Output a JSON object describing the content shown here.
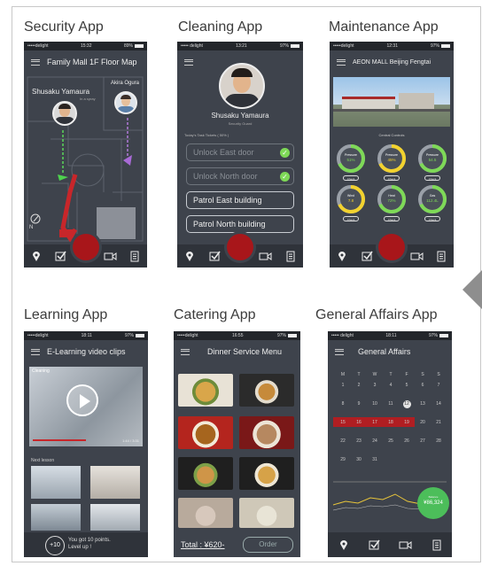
{
  "titles": {
    "security": "Security App",
    "cleaning": "Cleaning App",
    "maintenance": "Maintenance App",
    "learning": "Learning App",
    "catering": "Catering App",
    "general": "General Affairs App"
  },
  "status": {
    "carrier": "•••••delight",
    "carrier_b": "••••• delight",
    "carrier_c": "•••••delight",
    "carrier_d": "••••• delight",
    "battery": "89%",
    "battery_b": "97%",
    "battery_c": "97%",
    "battery_d": "97%",
    "battery_e": "97%",
    "battery_f": "97%",
    "time_a": "15:32",
    "time_b": "13:21",
    "time_c": "12:31",
    "time_d": "18:11",
    "time_e": "16:55",
    "time_f": "18:11"
  },
  "security": {
    "header": "Family Mall 1F Floor Map",
    "user1": "Shusaku Yamaura",
    "user1_sub": "In a spray",
    "user2": "Akira Ogura",
    "compass": "N"
  },
  "cleaning": {
    "name": "Shusaku Yamaura",
    "role": "Security Guard",
    "task_label": "Today's Task Tickets ( 50% )",
    "tasks": [
      "Unlock East door",
      "Unlock North door",
      "Patrol East building",
      "Patrol North building"
    ]
  },
  "maintenance": {
    "header": "AEON MALL Beijing Fengtai",
    "section": "Central Controls",
    "gauges": [
      {
        "label": "Pressure",
        "value": "51%",
        "color": "#7ed957",
        "btn": "Check"
      },
      {
        "label": "Pressure",
        "value": "45%",
        "color": "#f2d22e",
        "btn": "Check"
      },
      {
        "label": "Pressure",
        "value": "54.5",
        "color": "#7ed957",
        "btn": "Check"
      },
      {
        "label": "Wind",
        "value": "7.8",
        "color": "#f2d22e",
        "btn": "Check"
      },
      {
        "label": "Heat",
        "value": "72%",
        "color": "#7ed957",
        "btn": "Check"
      },
      {
        "label": "Gas",
        "value": "112.4L",
        "color": "#7ed957",
        "btn": "Check"
      }
    ]
  },
  "learning": {
    "header": "E-Learning video clips",
    "video_title": "Cleaning",
    "video_time": "1:44 / 3:31",
    "next": "Next lesson",
    "points": "+10",
    "points_msg": "You got 10 points.",
    "points_msg2": "Level up !"
  },
  "catering": {
    "header": "Dinner Service Menu",
    "total": "Total : ¥620-",
    "order": "Order"
  },
  "general": {
    "header": "General Affairs",
    "weekdays": [
      "M",
      "T",
      "W",
      "T",
      "F",
      "S",
      "S"
    ],
    "days": [
      [
        "1",
        "2",
        "3",
        "4",
        "5",
        "6",
        "7"
      ],
      [
        "8",
        "9",
        "10",
        "11",
        "12",
        "13",
        "14"
      ],
      [
        "15",
        "16",
        "17",
        "18",
        "19",
        "20",
        "21"
      ],
      [
        "22",
        "23",
        "24",
        "25",
        "26",
        "27",
        "28"
      ],
      [
        "29",
        "30",
        "31",
        "",
        "",
        "",
        ""
      ]
    ],
    "today": "12",
    "amount": "¥86,324",
    "amount_label": "Balance"
  },
  "colors": {
    "phone_bg": "#3e434c",
    "accent_red": "#a8161a",
    "highlight_row": "#b01e22",
    "bubble_green": "#4cbe5a"
  }
}
